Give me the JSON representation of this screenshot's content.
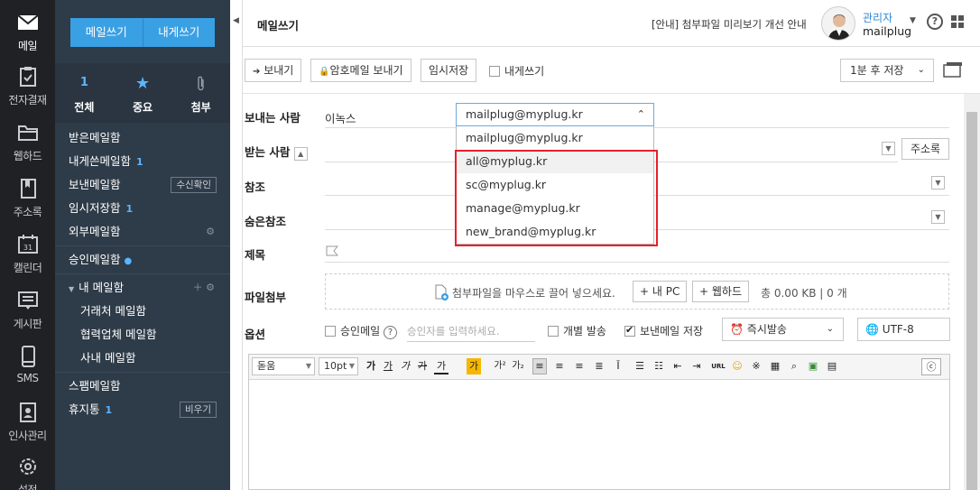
{
  "rail": {
    "items": [
      {
        "label": "메일",
        "icon": "mail-icon"
      },
      {
        "label": "전자결재",
        "icon": "clipboard-icon"
      },
      {
        "label": "웹하드",
        "icon": "folder-icon"
      },
      {
        "label": "주소록",
        "icon": "address-book-icon"
      },
      {
        "label": "캘린더",
        "icon": "calendar-icon",
        "day": "31"
      },
      {
        "label": "게시판",
        "icon": "board-icon"
      },
      {
        "label": "SMS",
        "icon": "phone-icon"
      },
      {
        "label": "인사관리",
        "icon": "id-badge-icon"
      },
      {
        "label": "설정",
        "icon": "gear-icon"
      }
    ]
  },
  "nav": {
    "compose": "메일쓰기",
    "to_me": "내게쓰기",
    "quick": [
      {
        "top": "1",
        "label": "전체"
      },
      {
        "top": "★",
        "label": "중요"
      },
      {
        "top": "📎",
        "label": "첨부"
      }
    ],
    "inbox": "받은메일함",
    "to_self_box": "내게쓴메일함",
    "to_self_count": "1",
    "sent": "보낸메일함",
    "read_receipt": "수신확인",
    "drafts": "임시저장함",
    "drafts_count": "1",
    "external": "외부메일함",
    "approval": "승인메일함",
    "my_box": "내 메일함",
    "my_sub": [
      "거래처 메일함",
      "협력업체 메일함",
      "사내 메일함"
    ],
    "spam": "스팸메일함",
    "trash": "휴지통",
    "trash_count": "1",
    "empty": "비우기"
  },
  "header": {
    "title": "메일쓰기",
    "notice": "[안내] 첨부파일 미리보기 개선 안내",
    "user_name": "관리자",
    "user_id": "mailplug"
  },
  "toolbar": {
    "send": "보내기",
    "send_encrypted": "암호메일 보내기",
    "save_draft": "임시저장",
    "to_self": "내게쓰기",
    "autosave": "1분 후 저장"
  },
  "form": {
    "sender_label": "보내는 사람",
    "sender_name": "이녹스",
    "sender_selected": "mailplug@myplug.kr",
    "sender_options": [
      "mailplug@myplug.kr",
      "all@myplug.kr",
      "sc@myplug.kr",
      "manage@myplug.kr",
      "new_brand@myplug.kr"
    ],
    "to_label": "받는 사람",
    "address_book": "주소록",
    "cc_label": "참조",
    "bcc_label": "숨은참조",
    "subject_label": "제목",
    "attach_label": "파일첨부",
    "attach_hint": "첨부파일을 마우스로 끌어 넣으세요.",
    "my_pc": "내 PC",
    "webhard": "웹하드",
    "quota": "총 0.00 KB | 0 개",
    "options_label": "옵션",
    "approval_mail": "승인메일",
    "approver_placeholder": "승인자를 입력하세요.",
    "individual_send": "개별 발송",
    "save_sent": "보낸메일 저장",
    "send_timing": "즉시발송",
    "encoding": "UTF-8"
  },
  "editor": {
    "font": "돋움",
    "size": "10pt"
  }
}
